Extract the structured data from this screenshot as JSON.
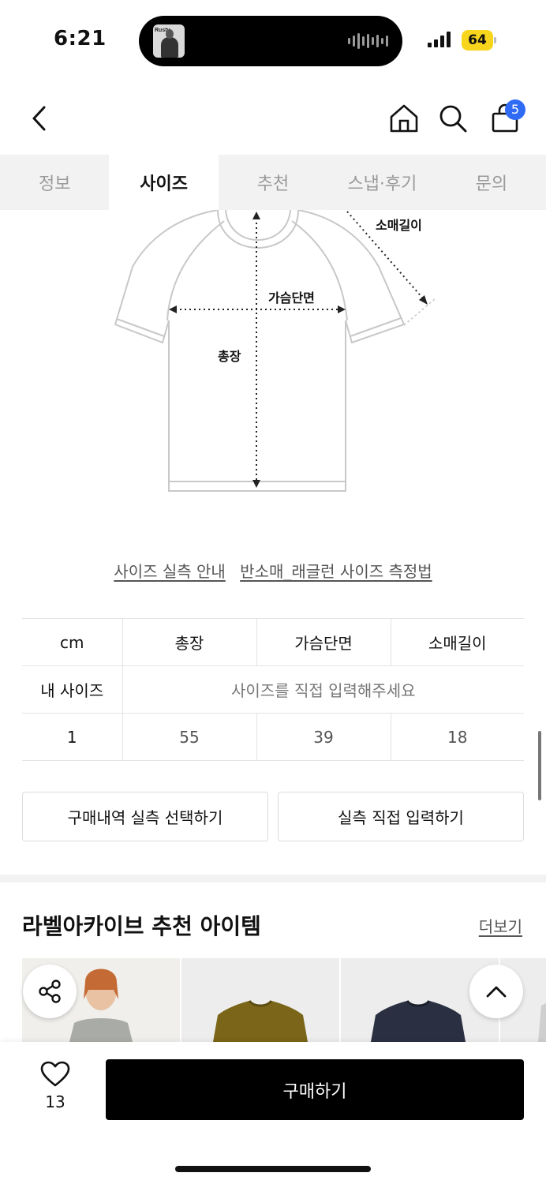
{
  "status_bar": {
    "time": "6:21",
    "battery": "64",
    "island_thumb_text": "Rusty"
  },
  "header": {
    "cart_count": "5"
  },
  "tabs": [
    {
      "label": "정보",
      "active": false
    },
    {
      "label": "사이즈",
      "active": true
    },
    {
      "label": "추천",
      "active": false
    },
    {
      "label": "스냅·후기",
      "active": false
    },
    {
      "label": "문의",
      "active": false
    }
  ],
  "diagram": {
    "sleeve_label": "소매길이",
    "chest_label": "가슴단면",
    "length_label": "총장"
  },
  "guide_links": {
    "link1": "사이즈 실측 안내",
    "link2": "반소매_래글런 사이즈 측정법"
  },
  "size_table": {
    "unit": "cm",
    "columns": [
      "총장",
      "가슴단면",
      "소매길이"
    ],
    "my_size_label": "내 사이즈",
    "my_size_placeholder": "사이즈를 직접 입력해주세요",
    "rows": [
      {
        "size": "1",
        "values": [
          "55",
          "39",
          "18"
        ]
      }
    ]
  },
  "buttons": {
    "select_purchase": "구매내역 실측 선택하기",
    "direct_input": "실측 직접 입력하기"
  },
  "recommend": {
    "title": "라벨아카이브 추천 아이템",
    "more": "더보기"
  },
  "bottom_bar": {
    "like_count": "13",
    "buy_label": "구매하기"
  },
  "colors": {
    "accent_blue": "#2f6bf5",
    "battery_yellow": "#f7d51d",
    "tab_bg": "#f2f2f2",
    "buy_button": "#000000"
  }
}
